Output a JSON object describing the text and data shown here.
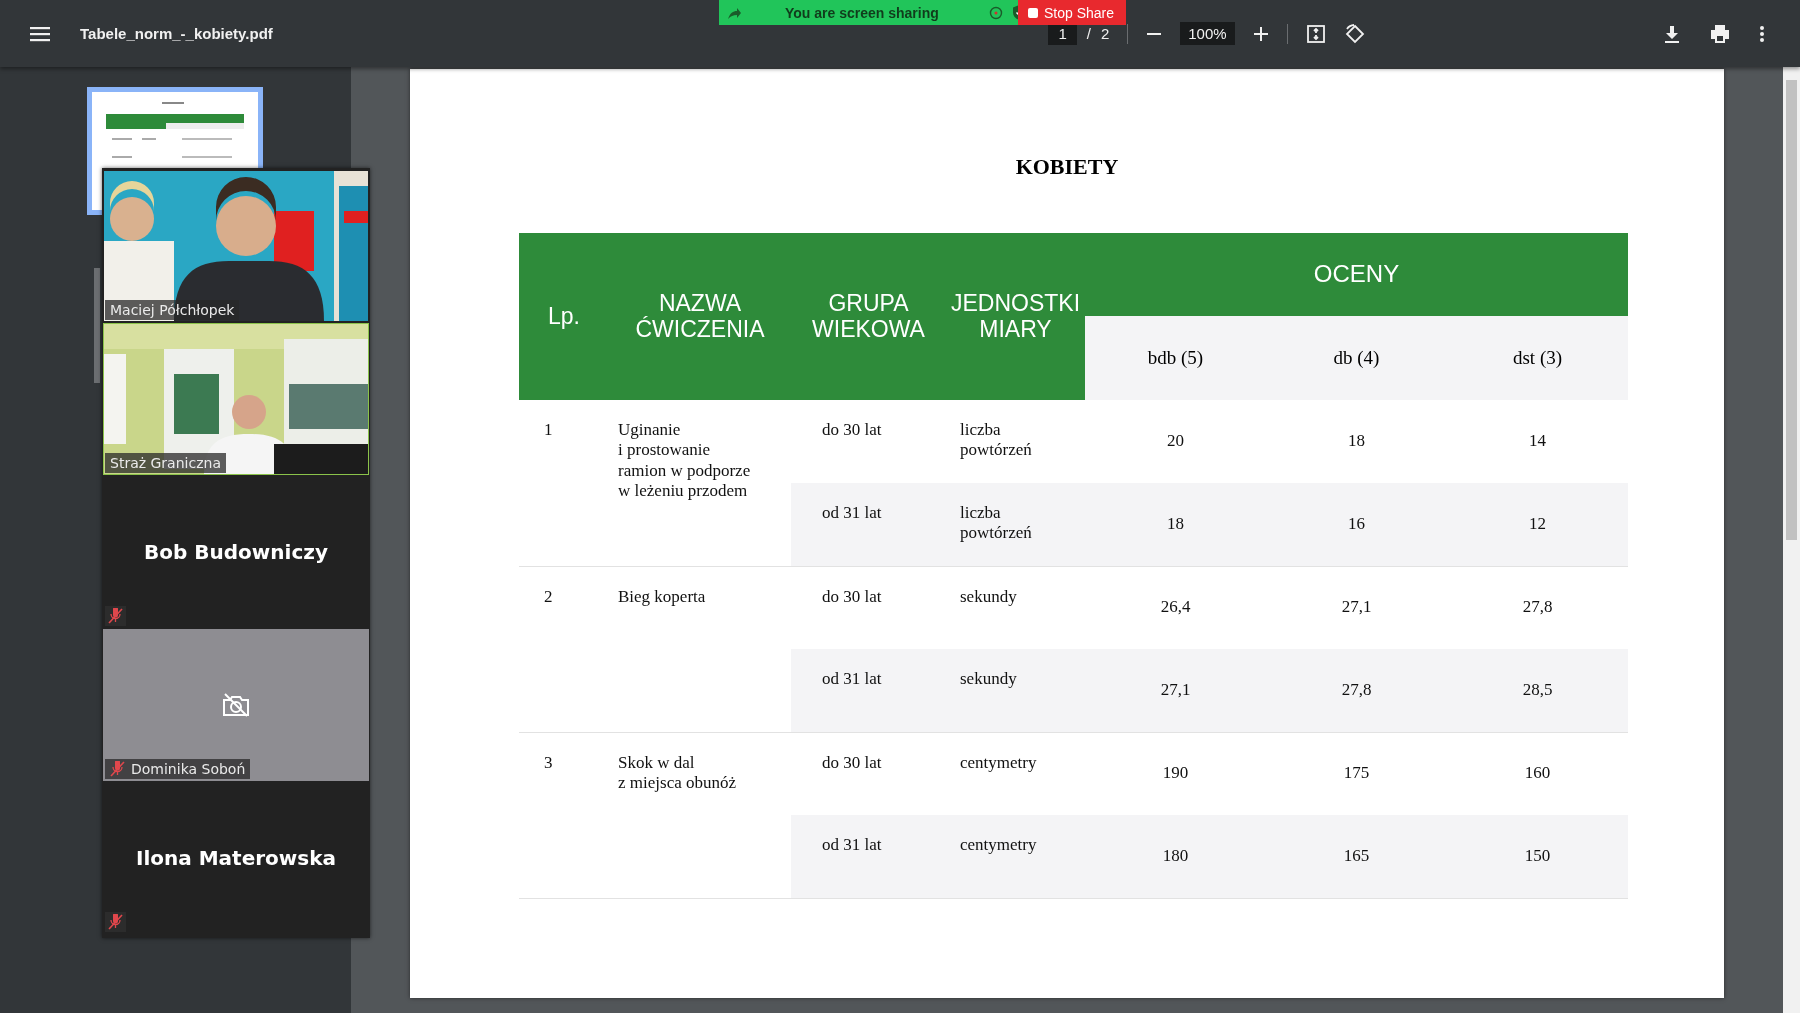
{
  "toolbar": {
    "file_name": "Tabele_norm_-_kobiety.pdf",
    "page_current": "1",
    "page_separator": "/",
    "page_total": "2",
    "zoom": "100%"
  },
  "share_banner": {
    "text": "You are screen sharing",
    "stop_label": "Stop Share"
  },
  "thumbnails": [
    {
      "selected": true
    }
  ],
  "participants": [
    {
      "name": "Maciej Półchłopek",
      "kind": "video",
      "muted": false,
      "speaking": false
    },
    {
      "name": "Straż Graniczna",
      "kind": "video",
      "muted": false,
      "speaking": true
    },
    {
      "name": "Bob Budowniczy",
      "kind": "name_only",
      "muted": true,
      "speaking": false
    },
    {
      "name": "Dominika Soboń",
      "kind": "camera_off",
      "muted": true,
      "speaking": false
    },
    {
      "name": "Ilona Materowska",
      "kind": "name_only",
      "muted": true,
      "speaking": false
    }
  ],
  "document": {
    "title": "KOBIETY",
    "table": {
      "columns": [
        "Lp.",
        "NAZWA\nĆWICZENIA",
        "GRUPA\nWIEKOWA",
        "JEDNOSTKI\nMIARY"
      ],
      "group_header": "OCENY",
      "grade_columns": [
        "bdb (5)",
        "db (4)",
        "dst (3)"
      ],
      "groups": [
        {
          "lp": "1",
          "exercise": "Uginanie\ni prostowanie\nramion w podporze\nw leżeniu przodem",
          "rows": [
            {
              "age": "do 30 lat",
              "unit": "liczba\npowtórzeń",
              "grades": [
                "20",
                "18",
                "14"
              ]
            },
            {
              "age": "od 31 lat",
              "unit": "liczba\npowtórzeń",
              "grades": [
                "18",
                "16",
                "12"
              ]
            }
          ]
        },
        {
          "lp": "2",
          "exercise": "Bieg koperta",
          "rows": [
            {
              "age": "do 30 lat",
              "unit": "sekundy",
              "grades": [
                "26,4",
                "27,1",
                "27,8"
              ]
            },
            {
              "age": "od 31 lat",
              "unit": "sekundy",
              "grades": [
                "27,1",
                "27,8",
                "28,5"
              ]
            }
          ]
        },
        {
          "lp": "3",
          "exercise": "Skok w dal\nz miejsca obunóż",
          "rows": [
            {
              "age": "do 30 lat",
              "unit": "centymetry",
              "grades": [
                "190",
                "175",
                "160"
              ]
            },
            {
              "age": "od 31 lat",
              "unit": "centymetry",
              "grades": [
                "180",
                "165",
                "150"
              ]
            }
          ]
        }
      ]
    }
  }
}
